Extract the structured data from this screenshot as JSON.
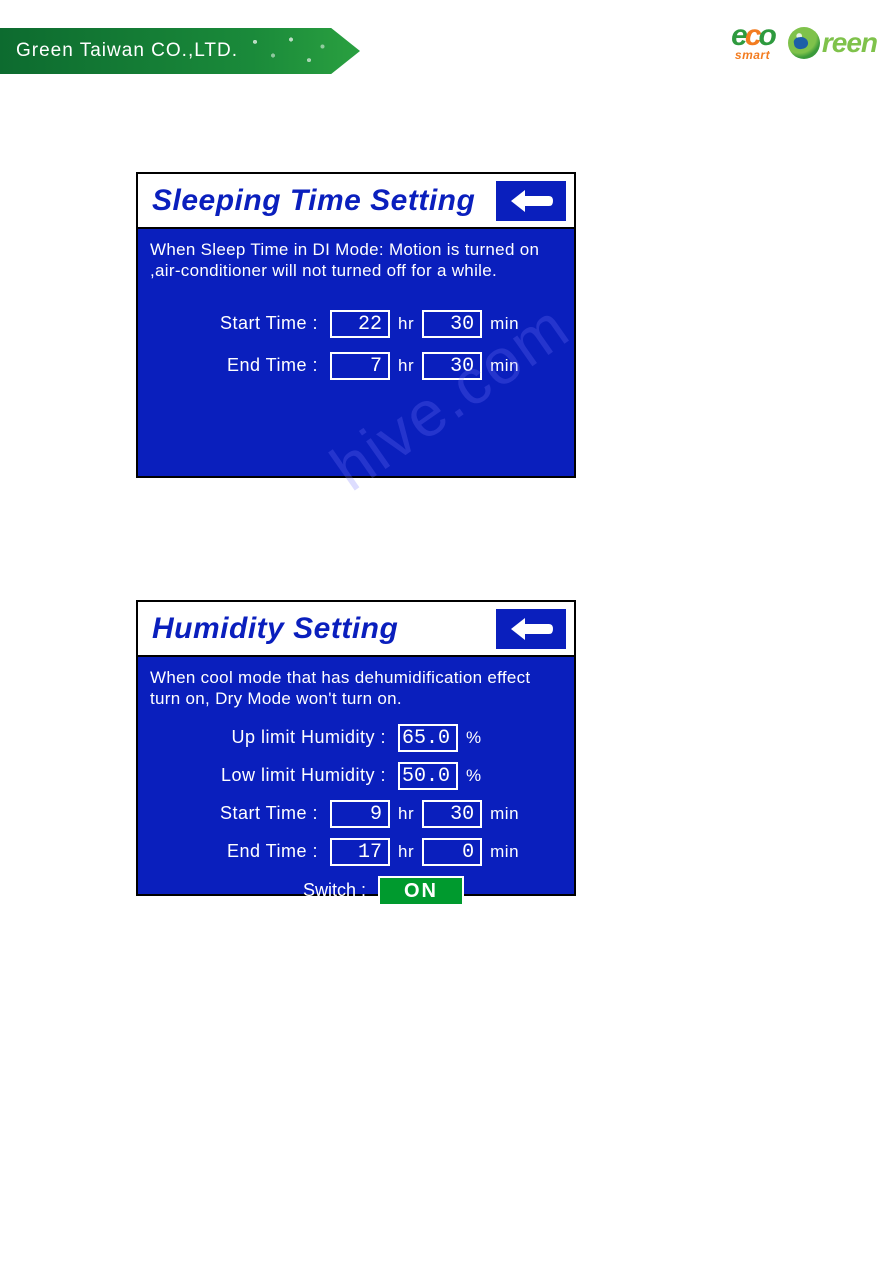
{
  "header": {
    "company": "Green Taiwan CO.,LTD.",
    "logo_eco_e": "e",
    "logo_eco_c": "c",
    "logo_eco_o": "o",
    "logo_eco_sub": "smart",
    "logo_green": "reen"
  },
  "watermark": "hive.com",
  "panel1": {
    "title": "Sleeping Time Setting",
    "desc": "When Sleep Time in DI Mode: Motion is turned on ,air-conditioner will not turned off for a while.",
    "start_label": "Start Time :",
    "end_label": "End Time :",
    "start_hr": "22",
    "start_min": "30",
    "end_hr": "7",
    "end_min": "30",
    "unit_hr": "hr",
    "unit_min": "min"
  },
  "panel2": {
    "title": "Humidity Setting",
    "desc": "When cool mode that has dehumidification effect turn on, Dry Mode won't turn on.",
    "up_label": "Up limit Humidity :",
    "low_label": "Low limit Humidity :",
    "up_val": "65.0",
    "low_val": "50.0",
    "pct": "%",
    "start_label": "Start Time :",
    "end_label": "End Time :",
    "start_hr": "9",
    "start_min": "30",
    "end_hr": "17",
    "end_min": "0",
    "unit_hr": "hr",
    "unit_min": "min",
    "switch_label": "Switch :",
    "switch_val": "ON"
  }
}
